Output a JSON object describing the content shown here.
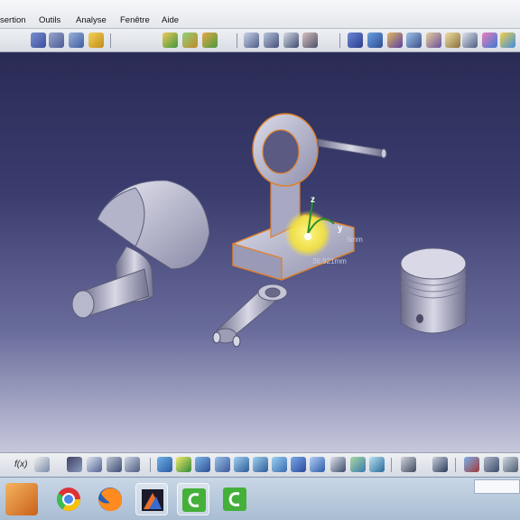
{
  "menu": {
    "items": [
      "sertion",
      "Outils",
      "Analyse",
      "Fenêtre",
      "Aide"
    ]
  },
  "viewport": {
    "compass": {
      "z_label": "z",
      "y_label": "y"
    },
    "measurements": [
      "9mm",
      "36.921mm"
    ]
  },
  "toolbar_bottom": {
    "formula_label": "f(x)"
  },
  "taskbar": {
    "apps": [
      "vlc-icon",
      "chrome-icon",
      "firefox-icon",
      "photo-editor-icon",
      "catia-icon",
      "catia-icon"
    ]
  },
  "colors": {
    "part_fill": "#c9c9dc",
    "selection": "#e0802a",
    "highlight": "#fff24a",
    "background_top": "#2a2b55"
  }
}
